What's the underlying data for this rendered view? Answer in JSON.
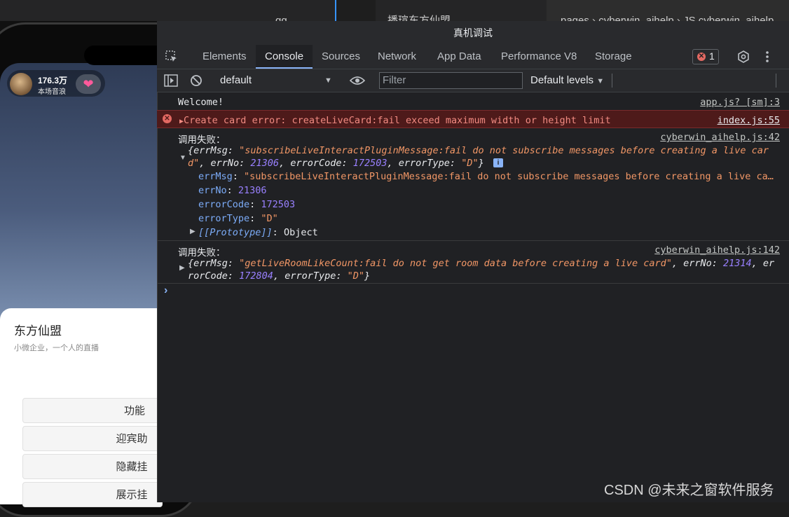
{
  "ide": {
    "fragment_a": "…gg",
    "fragment_b": "…播瑄东方仙盟",
    "fragment_c": "pages › cyberwin_aihelp › JS cyberwin_aihelp"
  },
  "phone": {
    "live_count": "176.3万",
    "live_sub": "本场音浪",
    "sheet_title": "东方仙盟",
    "sheet_subtitle": "小微企业，一个人的直播",
    "buttons": [
      "功能",
      "迎宾助",
      "隐藏挂",
      "展示挂"
    ]
  },
  "devtools": {
    "title": "真机调试",
    "tabs": [
      "Elements",
      "Console",
      "Sources",
      "Network",
      "App Data",
      "Performance V8",
      "Storage"
    ],
    "active_tab": "Console",
    "error_count": "1",
    "context": "default",
    "filter_placeholder": "Filter",
    "levels": "Default levels"
  },
  "console": {
    "welcome": "Welcome!",
    "welcome_src": "app.js? [sm]:3",
    "err_msg": "Create card error:  createLiveCard:fail exceed maximum width or height limit",
    "err_src": "index.js:55",
    "fail1_label": "调用失败：",
    "fail1_src": "cyberwin_aihelp.js:42",
    "fail1_line1_msg": "\"subscribeLiveInteractPluginMessage:fail do not subscribe messages before creating a live car",
    "fail1_line2_msg": "d\"",
    "fail1_errno": "21306",
    "fail1_errcode": "172503",
    "fail1_errtype": "\"D\"",
    "fail1_prop_errmsg": "\"subscribeLiveInteractPluginMessage:fail do not subscribe messages before creating a live ca…",
    "fail1_prop_errno": "21306",
    "fail1_prop_errcode": "172503",
    "fail1_prop_errtype": "\"D\"",
    "fail1_proto": "[[Prototype]]",
    "fail1_proto_val": "Object",
    "fail2_label": "调用失败：",
    "fail2_src": "cyberwin_aihelp.js:142",
    "fail2_msg": "\"getLiveRoomLikeCount:fail do not get room data before creating a live card\"",
    "fail2_errno": "21314",
    "fail2_errcode": "172804",
    "fail2_errtype": "\"D\""
  },
  "watermark": "CSDN @未来之窗软件服务",
  "colors": {
    "devtools_bg": "#202124",
    "error_bg": "#4e1a1a",
    "string": "#f29766",
    "number": "#9980ff",
    "accent": "#8ab4f8"
  }
}
